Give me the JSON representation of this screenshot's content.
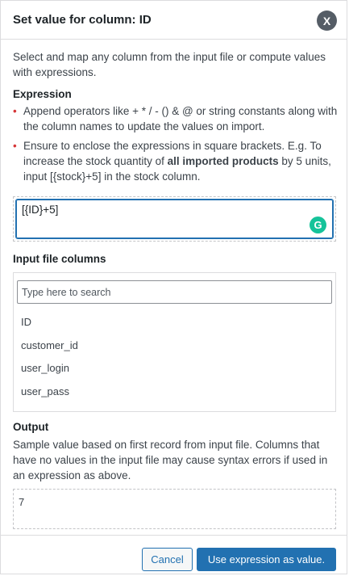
{
  "dialog": {
    "title": "Set value for column: ID",
    "close_label": "X"
  },
  "intro": "Select and map any column from the input file or compute values with expressions.",
  "expression": {
    "heading": "Expression",
    "bullet1": "Append operators like + * / - () & @ or string constants along with the column names to update the values on import.",
    "bullet2_part1": "Ensure to enclose the expressions in square brackets. E.g. To increase the stock quantity of ",
    "bullet2_bold": "all imported products",
    "bullet2_part2": " by 5 units, input [{stock}+5] in the stock column.",
    "value": "[{ID}+5]"
  },
  "input_columns": {
    "heading": "Input file columns",
    "search_placeholder": "Type here to search",
    "items": [
      "ID",
      "customer_id",
      "user_login",
      "user_pass"
    ]
  },
  "output": {
    "heading": "Output",
    "description": "Sample value based on first record from input file. Columns that have no values in the input file may cause syntax errors if used in an expression as above.",
    "value": "7"
  },
  "footer": {
    "cancel_label": "Cancel",
    "confirm_label": "Use expression as value."
  },
  "colors": {
    "accent": "#2271b1",
    "bullet": "#d63638",
    "grammarly": "#15c39a"
  },
  "icons": {
    "close": "close-icon",
    "grammarly": "grammarly-icon"
  }
}
